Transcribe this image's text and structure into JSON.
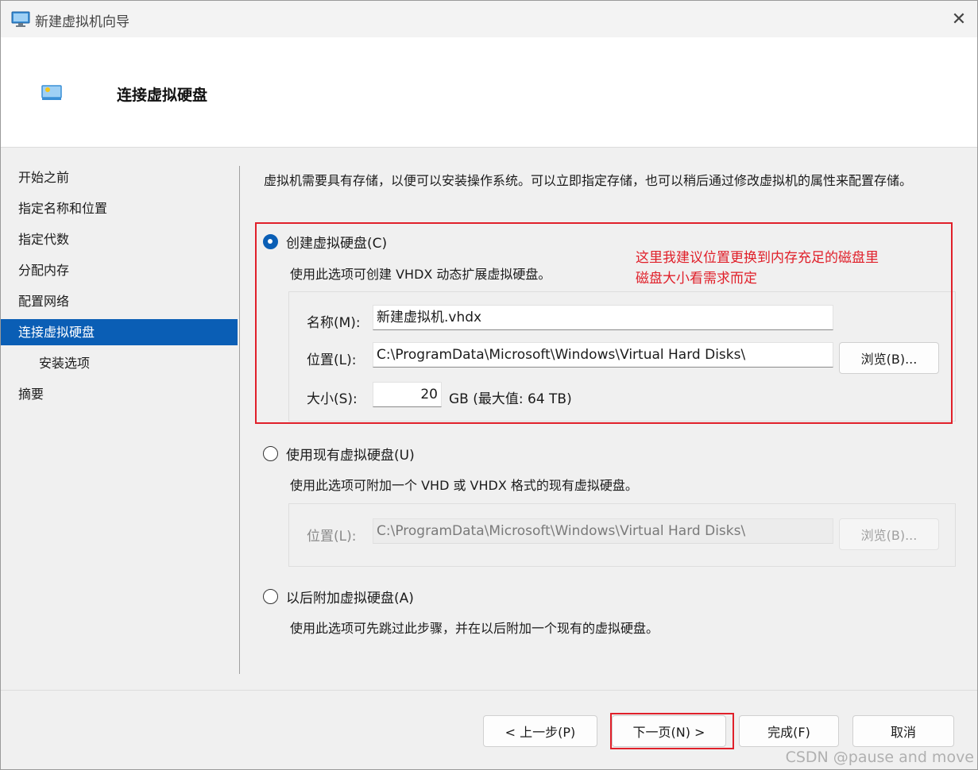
{
  "window": {
    "title": "新建虚拟机向导",
    "close_icon": "close-icon"
  },
  "header": {
    "title": "连接虚拟硬盘"
  },
  "sidebar": {
    "items": [
      {
        "label": "开始之前",
        "active": false,
        "sub": false
      },
      {
        "label": "指定名称和位置",
        "active": false,
        "sub": false
      },
      {
        "label": "指定代数",
        "active": false,
        "sub": false
      },
      {
        "label": "分配内存",
        "active": false,
        "sub": false
      },
      {
        "label": "配置网络",
        "active": false,
        "sub": false
      },
      {
        "label": "连接虚拟硬盘",
        "active": true,
        "sub": false
      },
      {
        "label": "安装选项",
        "active": false,
        "sub": true
      },
      {
        "label": "摘要",
        "active": false,
        "sub": false
      }
    ]
  },
  "main": {
    "intro": "虚拟机需要具有存储，以便可以安装操作系统。可以立即指定存储，也可以稍后通过修改虚拟机的属性来配置存储。",
    "create": {
      "label": "创建虚拟硬盘(C)",
      "selected": true,
      "desc": "使用此选项可创建 VHDX 动态扩展虚拟硬盘。",
      "name_label": "名称(M):",
      "name_value": "新建虚拟机.vhdx",
      "location_label": "位置(L):",
      "location_value": "C:\\ProgramData\\Microsoft\\Windows\\Virtual Hard Disks\\",
      "browse_label": "浏览(B)...",
      "size_label": "大小(S):",
      "size_value": "20",
      "size_unit": "GB (最大值: 64 TB)"
    },
    "existing": {
      "label": "使用现有虚拟硬盘(U)",
      "selected": false,
      "desc": "使用此选项可附加一个 VHD 或 VHDX 格式的现有虚拟硬盘。",
      "location_label": "位置(L):",
      "location_value": "C:\\ProgramData\\Microsoft\\Windows\\Virtual Hard Disks\\",
      "browse_label": "浏览(B)..."
    },
    "later": {
      "label": "以后附加虚拟硬盘(A)",
      "selected": false,
      "desc": "使用此选项可先跳过此步骤，并在以后附加一个现有的虚拟硬盘。"
    }
  },
  "annotation": {
    "line1": "这里我建议位置更换到内存充足的磁盘里",
    "line2": "磁盘大小看需求而定"
  },
  "footer": {
    "prev": "< 上一步(P)",
    "next": "下一页(N) >",
    "finish": "完成(F)",
    "cancel": "取消"
  },
  "watermark": "CSDN @pause and move",
  "colors": {
    "accent": "#0a5eb5",
    "annotation_red": "#e0202a"
  }
}
